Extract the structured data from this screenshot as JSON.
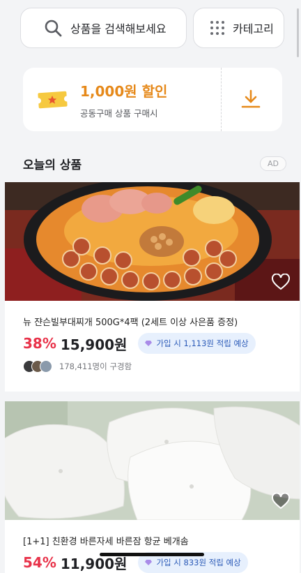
{
  "top": {
    "search_placeholder": "상품을 검색해보세요",
    "category_label": "카테고리"
  },
  "coupon": {
    "amount": "1,000원 할인",
    "desc": "공동구매 상품 구매시"
  },
  "section": {
    "title": "오늘의 상품",
    "ad_label": "AD"
  },
  "products": [
    {
      "title": "뉴 쟌슨빌부대찌개 500G*4팩 (2세트 이상 사은품 증정)",
      "discount": "38%",
      "price": "15,900원",
      "reward": "가입 시 1,113원 적립 예상",
      "buyers": "178,411명이 구경함"
    },
    {
      "title": "[1+1] 친환경 바른자세 바른잠 항균 베개솜",
      "discount": "54%",
      "price": "11,900원",
      "reward": "가입 시 833원 적립 예상"
    }
  ],
  "colors": {
    "accent_orange": "#e6891a",
    "discount_red": "#e8334a",
    "reward_blue": "#2c5bb8"
  }
}
